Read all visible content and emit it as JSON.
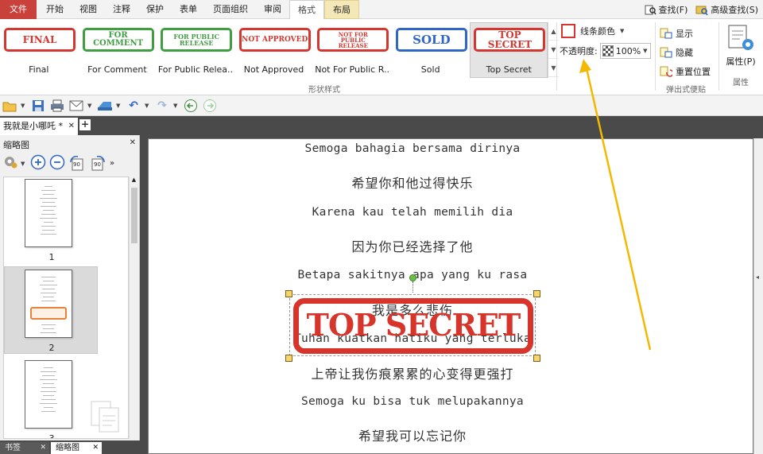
{
  "menubar": {
    "file": "文件",
    "tabs": [
      {
        "label": "开始"
      },
      {
        "label": "视图"
      },
      {
        "label": "注释"
      },
      {
        "label": "保护"
      },
      {
        "label": "表单"
      },
      {
        "label": "页面组织"
      },
      {
        "label": "审阅"
      },
      {
        "label": "格式"
      },
      {
        "label": "布局"
      }
    ],
    "find": "查找(F)",
    "advanced_find": "高级查找(S)"
  },
  "ribbon": {
    "stamps": [
      {
        "preview": "FINAL",
        "label": "Final",
        "color": "red"
      },
      {
        "preview": "FOR COMMENT",
        "label": "For Comment",
        "color": "green"
      },
      {
        "preview": "FOR PUBLIC RELEASE",
        "label": "For Public Relea..",
        "color": "green"
      },
      {
        "preview": "NOT APPROVED",
        "label": "Not Approved",
        "color": "red"
      },
      {
        "preview": "NOT FOR PUBLIC RELEASE",
        "label": "Not For Public R..",
        "color": "red"
      },
      {
        "preview": "SOLD",
        "label": "Sold",
        "color": "blue"
      },
      {
        "preview": "TOP SECRET",
        "label": "Top Secret",
        "color": "red"
      }
    ],
    "shape_style_group": "形状样式",
    "line_color_label": "线条颜色",
    "opacity_label": "不透明度:",
    "opacity_value": "100%",
    "popup_show": "显示",
    "popup_hide": "隐藏",
    "popup_reset": "重置位置",
    "popup_group": "弹出式便贴",
    "properties_label": "属性(P)",
    "properties_group": "属性"
  },
  "document_tab": {
    "title": "我就是小哪吒 *"
  },
  "thumbnails": {
    "title": "缩略图",
    "pages": [
      "1",
      "2",
      "3"
    ],
    "selected_page": "2",
    "rotate_left": "90",
    "rotate_right": "90"
  },
  "bottom_tabs": {
    "bookmarks": "书签",
    "thumbnails": "缩略图"
  },
  "page_lines": [
    {
      "text": "Semoga bahagia bersama dirinya",
      "cn": false
    },
    {
      "text": "希望你和他过得快乐",
      "cn": true
    },
    {
      "text": "Karena kau telah memilih dia",
      "cn": false
    },
    {
      "text": "因为你已经选择了他",
      "cn": true
    },
    {
      "text": "Betapa sakitnya apa yang ku rasa",
      "cn": false
    },
    {
      "text": "我是多么悲伤",
      "cn": true
    },
    {
      "text": "Tuhan kuatkan hatiku yang terluka",
      "cn": false
    },
    {
      "text": "上帝让我伤痕累累的心变得更强打",
      "cn": true
    },
    {
      "text": "Semoga ku bisa tuk melupakannya",
      "cn": false
    },
    {
      "text": "希望我可以忘记你",
      "cn": true
    }
  ],
  "stamp_on_page": {
    "text": "TOP SECRET",
    "color": "#d7352b"
  },
  "colors": {
    "file_menu": "#c8413b",
    "stamp_red": "#d4372f",
    "stamp_green": "#3f9f40",
    "stamp_blue": "#2f66c8",
    "arrow": "#f5b800"
  }
}
